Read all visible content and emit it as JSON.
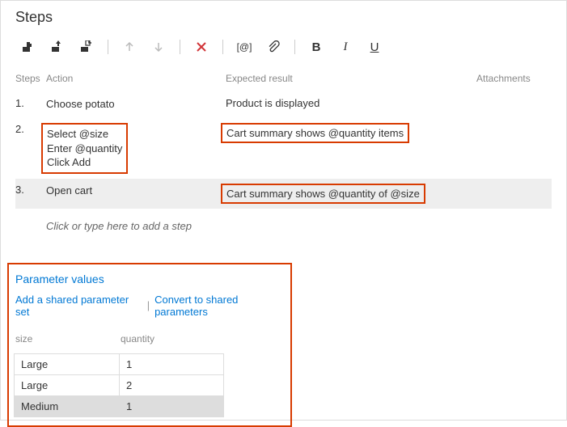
{
  "title": "Steps",
  "toolbar": {
    "at_label": "[@]",
    "bold": "B",
    "italic": "I",
    "underline": "U"
  },
  "grid": {
    "headers": {
      "steps": "Steps",
      "action": "Action",
      "expected": "Expected result",
      "attachments": "Attachments"
    },
    "rows": [
      {
        "num": "1.",
        "action": "Choose potato",
        "expected": "Product is displayed",
        "selected": false,
        "hl_action": false,
        "hl_expected": false
      },
      {
        "num": "2.",
        "action": "Select @size\nEnter @quantity\nClick Add",
        "expected": "Cart summary shows @quantity items",
        "selected": false,
        "hl_action": true,
        "hl_expected": true
      },
      {
        "num": "3.",
        "action": "Open cart",
        "expected": "Cart summary shows @quantity of @size",
        "selected": true,
        "hl_action": false,
        "hl_expected": true
      }
    ],
    "placeholder": "Click or type here to add a step"
  },
  "params": {
    "title": "Parameter values",
    "link_add": "Add a shared parameter set",
    "link_convert": "Convert to shared parameters",
    "headers": {
      "size": "size",
      "quantity": "quantity"
    },
    "rows": [
      {
        "size": "Large",
        "quantity": "1",
        "selected": false
      },
      {
        "size": "Large",
        "quantity": "2",
        "selected": false
      },
      {
        "size": "Medium",
        "quantity": "1",
        "selected": true
      }
    ]
  }
}
